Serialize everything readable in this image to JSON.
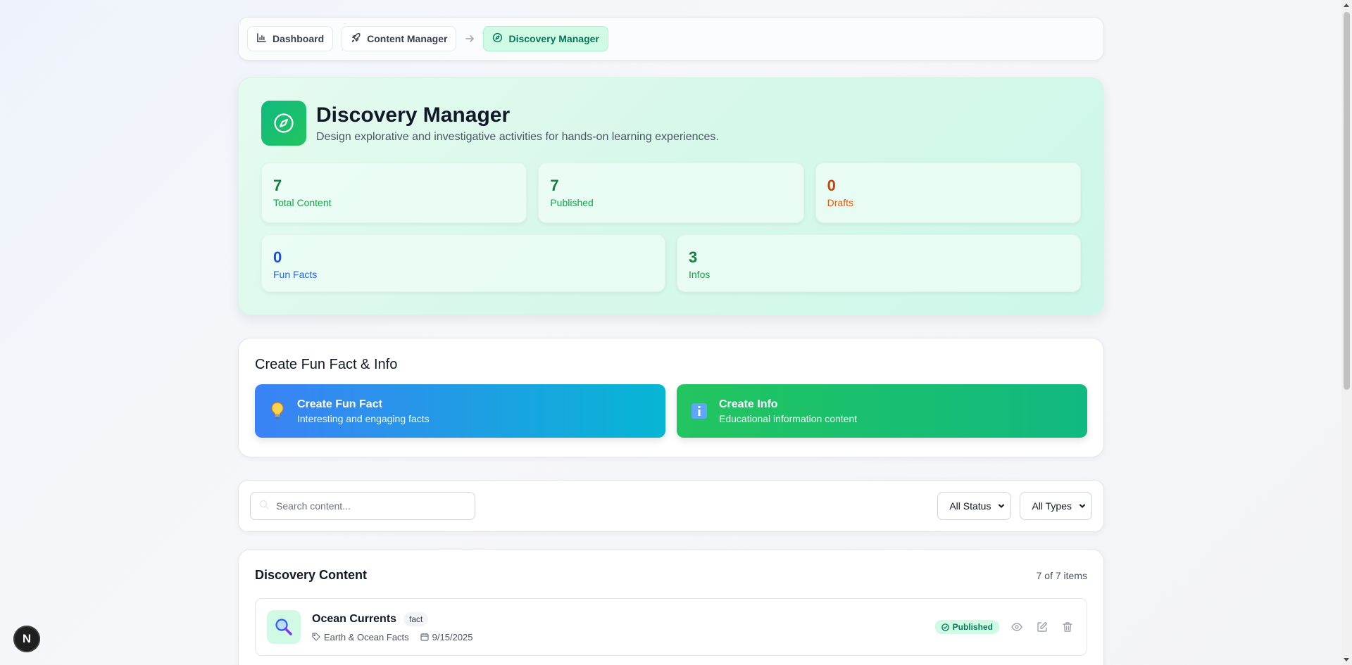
{
  "breadcrumb": {
    "items": [
      {
        "label": "Dashboard",
        "icon": "chart-bar-icon"
      },
      {
        "label": "Content Manager",
        "icon": "rocket-icon"
      },
      {
        "label": "Discovery Manager",
        "icon": "compass-icon",
        "active": true
      }
    ]
  },
  "hero": {
    "title": "Discovery Manager",
    "subtitle": "Design explorative and investigative activities for hands-on learning experiences.",
    "icon": "compass-icon",
    "stats": [
      {
        "value": "7",
        "label": "Total Content",
        "color": "#15803d"
      },
      {
        "value": "7",
        "label": "Published",
        "color": "#15803d"
      },
      {
        "value": "0",
        "label": "Drafts",
        "color": "#c2410c"
      },
      {
        "value": "0",
        "label": "Fun Facts",
        "color": "#1d4ed8"
      },
      {
        "value": "3",
        "label": "Infos",
        "color": "#15803d"
      }
    ]
  },
  "create": {
    "title": "Create Fun Fact & Info",
    "fun_fact": {
      "title": "Create Fun Fact",
      "subtitle": "Interesting and engaging facts",
      "icon": "lightbulb-icon"
    },
    "info": {
      "title": "Create Info",
      "subtitle": "Educational information content",
      "icon": "info-icon"
    }
  },
  "filters": {
    "search_placeholder": "Search content...",
    "status_value": "All Status",
    "type_value": "All Types"
  },
  "list": {
    "title": "Discovery Content",
    "count": "7 of 7 items",
    "items": [
      {
        "title": "Ocean Currents",
        "tag": "fact",
        "category": "Earth & Ocean Facts",
        "date": "9/15/2025",
        "status": "Published",
        "icon": "magnifier-icon"
      }
    ]
  },
  "nextjs_badge": "N",
  "colors": {
    "accent_green": "#10b981",
    "accent_blue": "#3b82f6",
    "accent_cyan": "#06b6d4"
  }
}
